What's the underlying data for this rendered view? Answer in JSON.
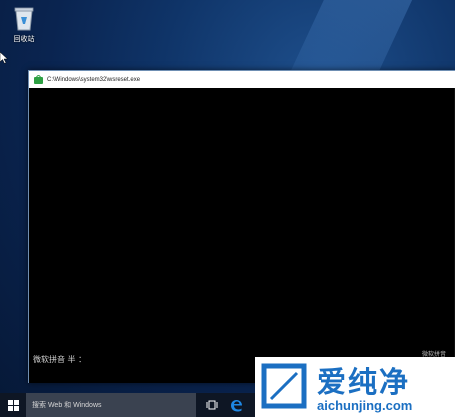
{
  "desktop": {
    "recycle_bin_label": "回收站"
  },
  "console": {
    "title": "C:\\Windows\\system32\\wsreset.exe",
    "ime_status": "微软拼音",
    "ime_input_line": "微软拼音 半 ："
  },
  "taskbar": {
    "search_placeholder": "搜索 Web 和 Windows"
  },
  "watermark": {
    "title": "爱纯净",
    "url": "aichunjing.com"
  },
  "colors": {
    "console_bg": "#000000",
    "title_bar": "#ffffff",
    "taskbar": "#0e1624",
    "search_box": "#3a4250",
    "edge_blue": "#1e88e5",
    "app_icon_green": "#2ea043",
    "watermark_blue": "#1b6fc2"
  },
  "icons": {
    "recycle_bin": "recycle-bin-icon",
    "app": "store-icon",
    "start": "windows-logo-icon",
    "task_view": "task-view-icon",
    "edge": "edge-icon",
    "cursor": "mouse-cursor-icon"
  }
}
